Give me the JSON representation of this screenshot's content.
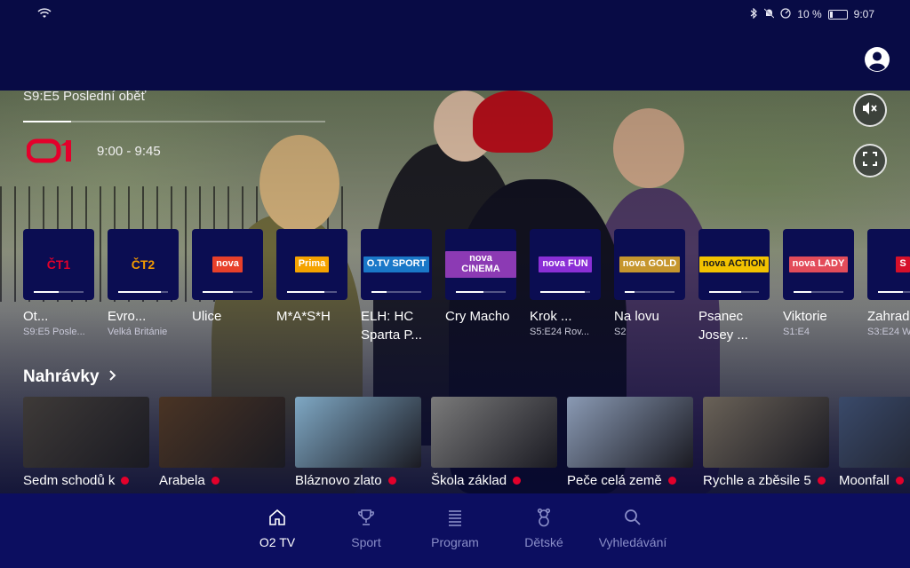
{
  "status": {
    "battery": "10 %",
    "time": "9:07"
  },
  "hero": {
    "episode": "S9:E5 Poslední oběť",
    "channel_logo": "ČT1",
    "time": "9:00 - 9:45",
    "progress": 0.16
  },
  "channels": [
    {
      "logo": "ČT1",
      "name": "Ot...",
      "sub": "S9:E5 Posle...",
      "progress": 0.5,
      "color": "#e3002b"
    },
    {
      "logo": "ČT2",
      "name": "Evro...",
      "sub": "Velká Británie",
      "progress": 0.85,
      "color": "#f29a00"
    },
    {
      "logo": "nova",
      "name": "Ulice",
      "sub": "",
      "progress": 0.6,
      "color": "#e8402a"
    },
    {
      "logo": "Prima",
      "name": "M*A*S*H",
      "sub": "",
      "progress": 0.75,
      "color": "#f5a300"
    },
    {
      "logo": "O.TV SPORT",
      "name": "ELH: HC Sparta P...",
      "sub": "",
      "progress": 0.3,
      "color": "#1a78c8"
    },
    {
      "logo": "nova CINEMA",
      "name": "Cry Macho",
      "sub": "",
      "progress": 0.55,
      "color": "#8c3ab4"
    },
    {
      "logo": "nova FUN",
      "name": "Krok ...",
      "sub": "S5:E24 Rov...",
      "progress": 0.9,
      "color": "#8b2fd6"
    },
    {
      "logo": "nova GOLD",
      "name": "Na lovu",
      "sub": "S2",
      "progress": 0.2,
      "color": "#c6962e"
    },
    {
      "logo": "nova ACTION",
      "name": "Psanec Josey ...",
      "sub": "",
      "progress": 0.65,
      "color": "#f2c200"
    },
    {
      "logo": "nova LADY",
      "name": "Viktorie",
      "sub": "S1:E4",
      "progress": 0.35,
      "color": "#e34c5a"
    },
    {
      "logo": "S",
      "name": "Zahrad...",
      "sub": "S3:E24 W",
      "progress": 0.5,
      "color": "#d6102a"
    }
  ],
  "recordings": {
    "heading": "Nahrávky",
    "items": [
      {
        "title": "Sedm schodů k",
        "color": "#3e3a38"
      },
      {
        "title": "Arabela",
        "color": "#4a3424"
      },
      {
        "title": "Bláznovo zlato",
        "color": "#7fa8c4"
      },
      {
        "title": "Škola základ",
        "color": "#7a7a7a"
      },
      {
        "title": "Peče celá země",
        "color": "#8a9ab4"
      },
      {
        "title": "Rychle a zběsile 5",
        "color": "#6a6258"
      },
      {
        "title": "Moonfall",
        "color": "#3a4a6a"
      }
    ]
  },
  "nav": [
    {
      "label": "O2 TV",
      "icon": "home-icon",
      "active": true
    },
    {
      "label": "Sport",
      "icon": "trophy-icon",
      "active": false
    },
    {
      "label": "Program",
      "icon": "list-icon",
      "active": false
    },
    {
      "label": "Dětské",
      "icon": "teddy-bear-icon",
      "active": false
    },
    {
      "label": "Vyhledávání",
      "icon": "search-icon",
      "active": false
    }
  ]
}
